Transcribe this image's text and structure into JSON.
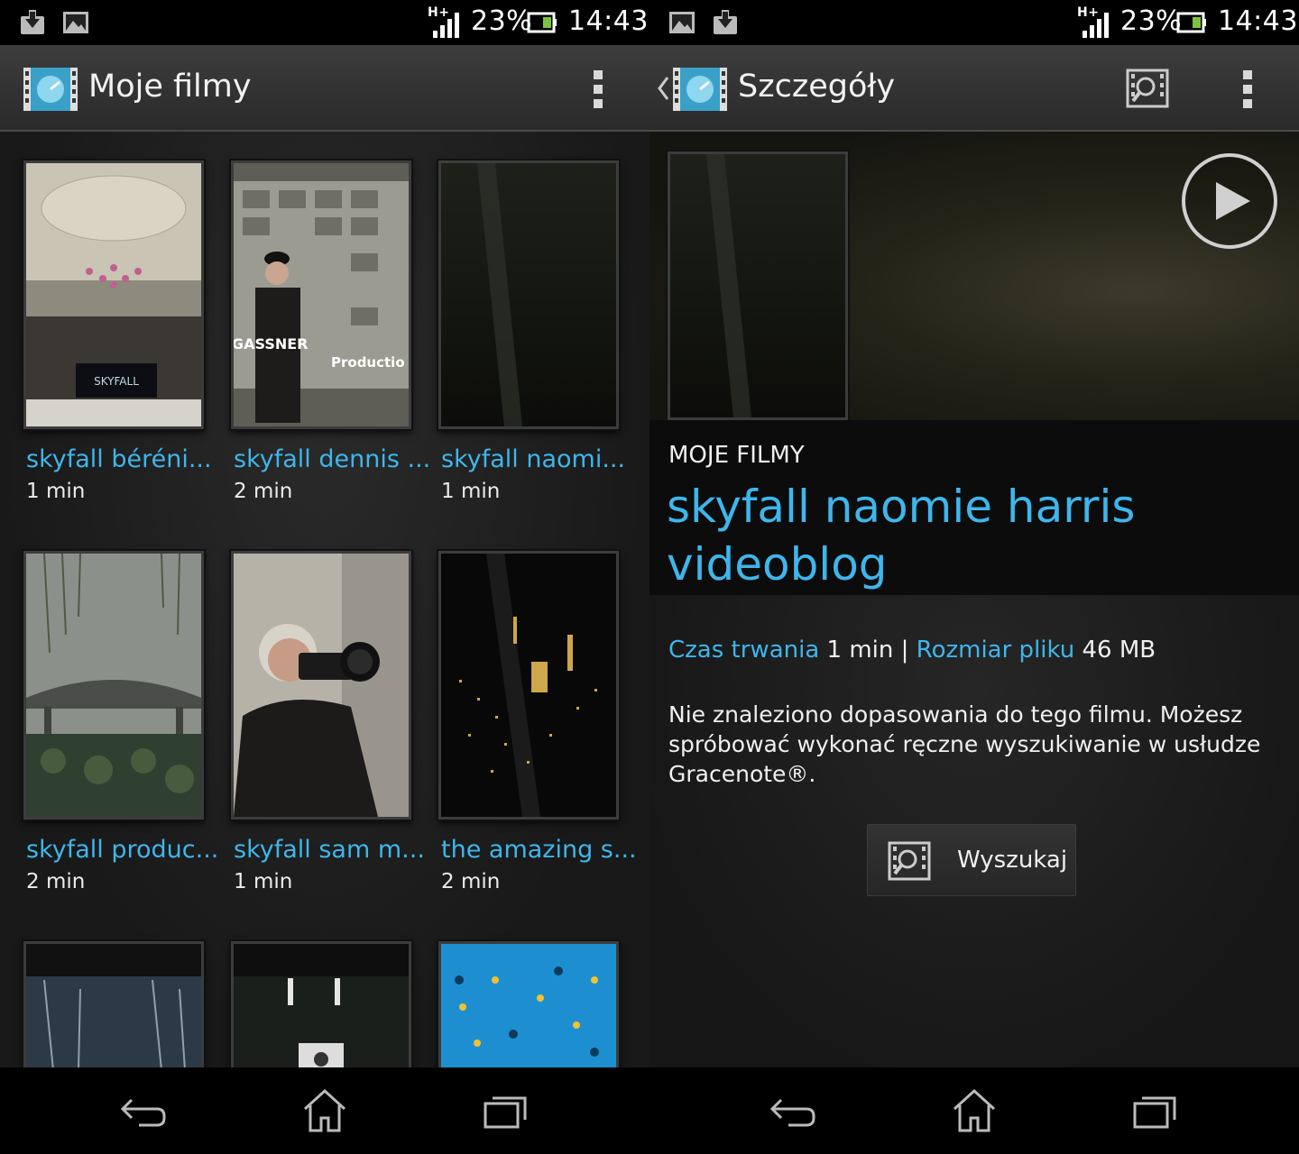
{
  "status_bar": {
    "network": "H+",
    "battery_percent": "23%",
    "time": "14:43"
  },
  "library": {
    "title": "Moje filmy",
    "icons": [
      "download-icon",
      "image-icon",
      "overflow-menu-icon"
    ],
    "videos": [
      {
        "title": "skyfall béréni...",
        "duration": "1 min",
        "overlay_lines": [
          "SKYFALL"
        ]
      },
      {
        "title": "skyfall dennis ...",
        "duration": "2 min",
        "overlay_lines": [
          "GASSNER",
          "Productio"
        ]
      },
      {
        "title": "skyfall naomi...",
        "duration": "1 min",
        "overlay_lines": []
      },
      {
        "title": "skyfall produc...",
        "duration": "2 min",
        "overlay_lines": []
      },
      {
        "title": "skyfall sam m...",
        "duration": "1 min",
        "overlay_lines": []
      },
      {
        "title": "the amazing s...",
        "duration": "2 min",
        "overlay_lines": []
      },
      {
        "title": "",
        "duration": "",
        "overlay_lines": []
      },
      {
        "title": "",
        "duration": "",
        "overlay_lines": []
      },
      {
        "title": "",
        "duration": "",
        "overlay_lines": []
      }
    ]
  },
  "details": {
    "title": "Szczegóły",
    "breadcrumb": "MOJE FILMY",
    "video_title_line1": "skyfall naomie harris",
    "video_title_line2": "videoblog",
    "duration_label": "Czas trwania",
    "duration_value": "1 min",
    "separator": "|",
    "size_label": "Rozmiar pliku",
    "size_value": "46 MB",
    "message": "Nie znaleziono dopasowania do tego filmu. Możesz spróbować wykonać ręczne wyszukiwanie w usłudze Gracenote®.",
    "search_button": "Wyszukaj"
  },
  "nav_bar": {
    "icons": [
      "back-icon",
      "home-icon",
      "recent-apps-icon"
    ]
  },
  "colors": {
    "accent": "#3eb6ec",
    "background": "#1c1c1c",
    "action_bar": "#333333"
  }
}
